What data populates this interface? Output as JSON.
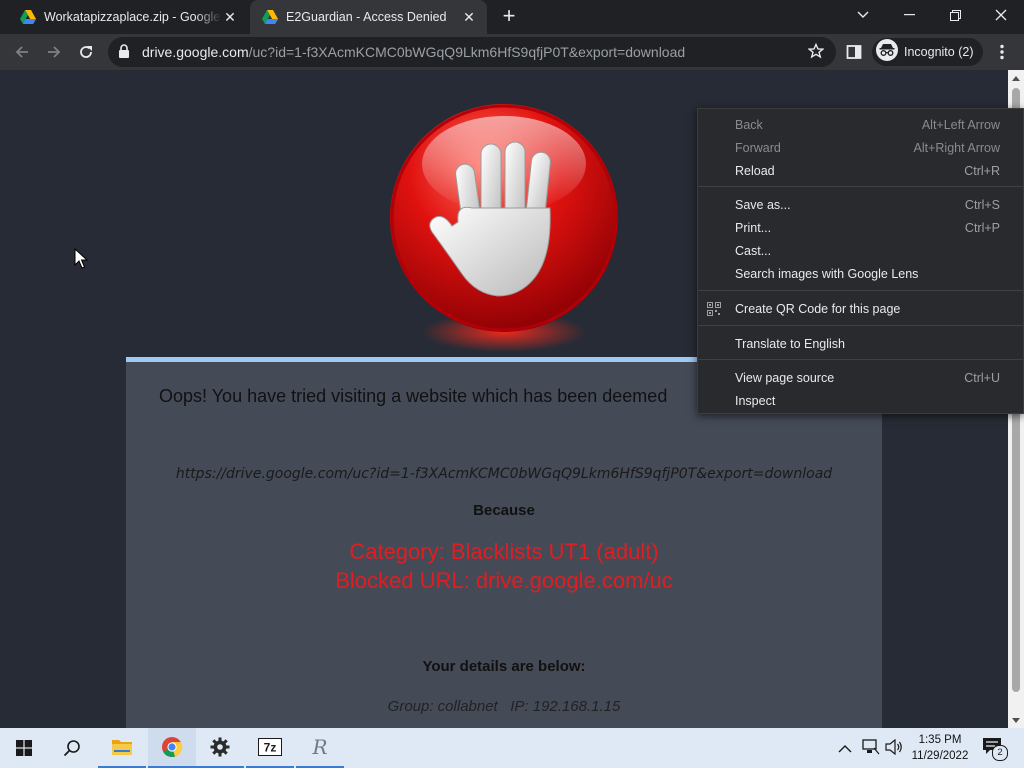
{
  "browser": {
    "tabs": [
      {
        "title": "Workatapizzaplace.zip - Google Drive",
        "favicon": "google-drive-icon",
        "active": false
      },
      {
        "title": "E2Guardian - Access Denied",
        "favicon": "google-drive-icon",
        "active": true
      }
    ],
    "new_tab_symbol": "+",
    "address": {
      "host": "drive.google.com",
      "path": "/uc?id=1-f3XAcmKCMC0bWGqQ9Lkm6HfS9qfjP0T&export=download"
    },
    "profile_label": "Incognito (2)"
  },
  "page": {
    "heading": "Oops! You have tried visiting a website which has been deemed",
    "blocked_url": "https://drive.google.com/uc?id=1-f3XAcmKCMC0bWGqQ9Lkm6HfS9qfjP0T&export=download",
    "because_label": "Because",
    "reason_category": "Category: Blacklists UT1 (adult)",
    "reason_blocked_url": "Blocked URL: drive.google.com/uc",
    "details_heading": "Your details are below:",
    "details_line": "Group: collabnet   IP: 192.168.1.15"
  },
  "context_menu": {
    "groups": [
      [
        {
          "label": "Back",
          "shortcut": "Alt+Left Arrow",
          "enabled": false
        },
        {
          "label": "Forward",
          "shortcut": "Alt+Right Arrow",
          "enabled": false
        },
        {
          "label": "Reload",
          "shortcut": "Ctrl+R",
          "enabled": true
        }
      ],
      [
        {
          "label": "Save as...",
          "shortcut": "Ctrl+S",
          "enabled": true
        },
        {
          "label": "Print...",
          "shortcut": "Ctrl+P",
          "enabled": true
        },
        {
          "label": "Cast...",
          "shortcut": "",
          "enabled": true
        },
        {
          "label": "Search images with Google Lens",
          "shortcut": "",
          "enabled": true
        }
      ],
      [
        {
          "label": "Create QR Code for this page",
          "shortcut": "",
          "enabled": true,
          "icon": "qr-code-icon"
        }
      ],
      [
        {
          "label": "Translate to English",
          "shortcut": "",
          "enabled": true
        }
      ],
      [
        {
          "label": "View page source",
          "shortcut": "Ctrl+U",
          "enabled": true
        },
        {
          "label": "Inspect",
          "shortcut": "",
          "enabled": true
        }
      ]
    ]
  },
  "taskbar": {
    "apps": [
      "windows-start-icon",
      "search-icon",
      "file-explorer-icon",
      "chrome-icon",
      "settings-icon",
      "7zip-icon",
      "r-app-icon"
    ],
    "clock_time": "1:35 PM",
    "clock_date": "11/29/2022",
    "notification_count": "2"
  },
  "colors": {
    "accent_blue": "#9ccaf3",
    "blocked_red": "#e21d21",
    "page_bg": "#272b35",
    "panel_bg": "#454a57"
  }
}
